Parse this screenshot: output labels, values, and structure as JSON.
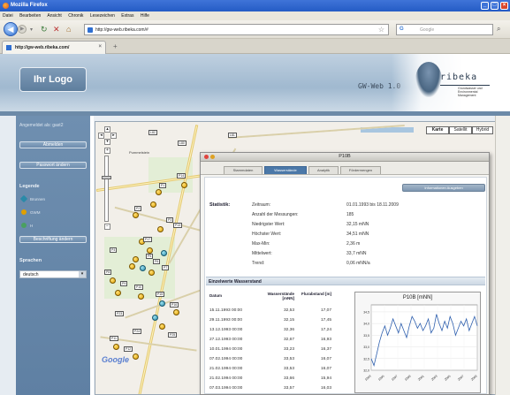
{
  "window": {
    "title": "Mozilla Firefox",
    "accent": "#2a5fc9"
  },
  "menu": [
    "Datei",
    "Bearbeiten",
    "Ansicht",
    "Chronik",
    "Lesezeichen",
    "Extras",
    "Hilfe"
  ],
  "nav": {
    "url": "http://gw-web.ribeka.com/#",
    "search_placeholder": "Google",
    "search_engine": "G"
  },
  "tab": {
    "label": "http://gw-web.ribeka.com/"
  },
  "header": {
    "logo_text": "Ihr Logo",
    "product": "GW-Web 1.0",
    "brand": "ribeka",
    "brand_sub": "Grundwasser und Environmental Management"
  },
  "sidebar": {
    "login_text": "Angemeldet als: gast2",
    "logout_button": "Abmelden",
    "password_button": "Passwort ändern",
    "legend_title": "Legende",
    "legend": [
      {
        "label": "Brunnen",
        "color": "#2a8aa8"
      },
      {
        "label": "GWM",
        "color": "#e0a000"
      },
      {
        "label": "H",
        "color": "#4aa060"
      }
    ],
    "filter_button": "Beschriftung ändern",
    "language_title": "Sprachen",
    "language_value": "deutsch"
  },
  "map": {
    "tabs": [
      "Karte",
      "Satellit",
      "Hybrid"
    ],
    "place_label": "Pummelstein",
    "route_labels": [
      "L82",
      "L81",
      "L80"
    ],
    "marker_tags": [
      "P1",
      "P14",
      "P2",
      "P3",
      "P13",
      "P4",
      "P17",
      "P5",
      "P6",
      "P7",
      "P8",
      "P9",
      "P10",
      "P15",
      "P16",
      "P23",
      "P24",
      "P11",
      "P12",
      "P25"
    ],
    "brand": "Google"
  },
  "popup": {
    "title": "P10B",
    "tabs": [
      "Stammdaten",
      "Wasserstände",
      "Analytik",
      "Fördermengen"
    ],
    "active_tab": 1,
    "help_button": "Informationen Ausgeben",
    "stats_title": "Statistik:",
    "stats": [
      {
        "label": "Zeitraum:",
        "value": "01.01.1993 bis 18.11.2009"
      },
      {
        "label": "Anzahl der Messungen:",
        "value": "185"
      },
      {
        "label": "Niedrigster Wert:",
        "value": "32,15 mNN"
      },
      {
        "label": "Höchster Wert:",
        "value": "34,51 mNN"
      },
      {
        "label": "Max-Min:",
        "value": "2,36 m"
      },
      {
        "label": "Mittelwert:",
        "value": "33,7 mNN"
      },
      {
        "label": "Trend:",
        "value": "0,06 mNN/a"
      }
    ],
    "section_title": "Einzelwerte Wasserstand",
    "columns": [
      "Datum",
      "Wasserstände [mNN]",
      "Flurabstand [m]"
    ],
    "rows": [
      [
        "15.11.1993 00:00",
        "32,53",
        "17,07"
      ],
      [
        "29.11.1993 00:00",
        "32,15",
        "17,45"
      ],
      [
        "13.12.1993 00:00",
        "32,36",
        "17,24"
      ],
      [
        "27.12.1993 00:00",
        "32,67",
        "16,93"
      ],
      [
        "10.01.1994 00:00",
        "33,23",
        "16,37"
      ],
      [
        "07.02.1994 00:00",
        "33,53",
        "16,07"
      ],
      [
        "21.02.1994 00:00",
        "33,53",
        "16,07"
      ],
      [
        "21.02.1994 00:00",
        "33,66",
        "15,94"
      ],
      [
        "07.03.1994 00:00",
        "33,57",
        "16,03"
      ],
      [
        "21.03.1994 00:00",
        "33,66",
        "15,94"
      ],
      [
        "05.04.1994 00:00",
        "33,78",
        "15,82"
      ]
    ]
  },
  "chart_data": {
    "type": "line",
    "title": "P10B [mNN]",
    "xlabel": "",
    "ylabel": "",
    "ylim": [
      32.0,
      34.8
    ],
    "x_tick_labels": [
      "1993",
      "1995",
      "1997",
      "1999",
      "2001",
      "2003",
      "2005",
      "2007",
      "2009"
    ],
    "y_tick_labels": [
      "32,0",
      "32,5",
      "33,0",
      "33,5",
      "34,0",
      "34,5"
    ],
    "series": [
      {
        "values": [
          32.5,
          32.2,
          32.7,
          33.2,
          33.6,
          33.9,
          33.5,
          33.8,
          34.2,
          33.9,
          33.6,
          34.0,
          33.7,
          33.4,
          33.9,
          34.3,
          34.1,
          33.8,
          34.0,
          33.7,
          33.9,
          34.2,
          33.6,
          33.8,
          34.4,
          34.0,
          33.7,
          34.1,
          33.8,
          34.3,
          34.0,
          33.5,
          33.8,
          34.1,
          33.9,
          34.2,
          33.7,
          34.0,
          34.3,
          33.9
        ]
      }
    ]
  }
}
